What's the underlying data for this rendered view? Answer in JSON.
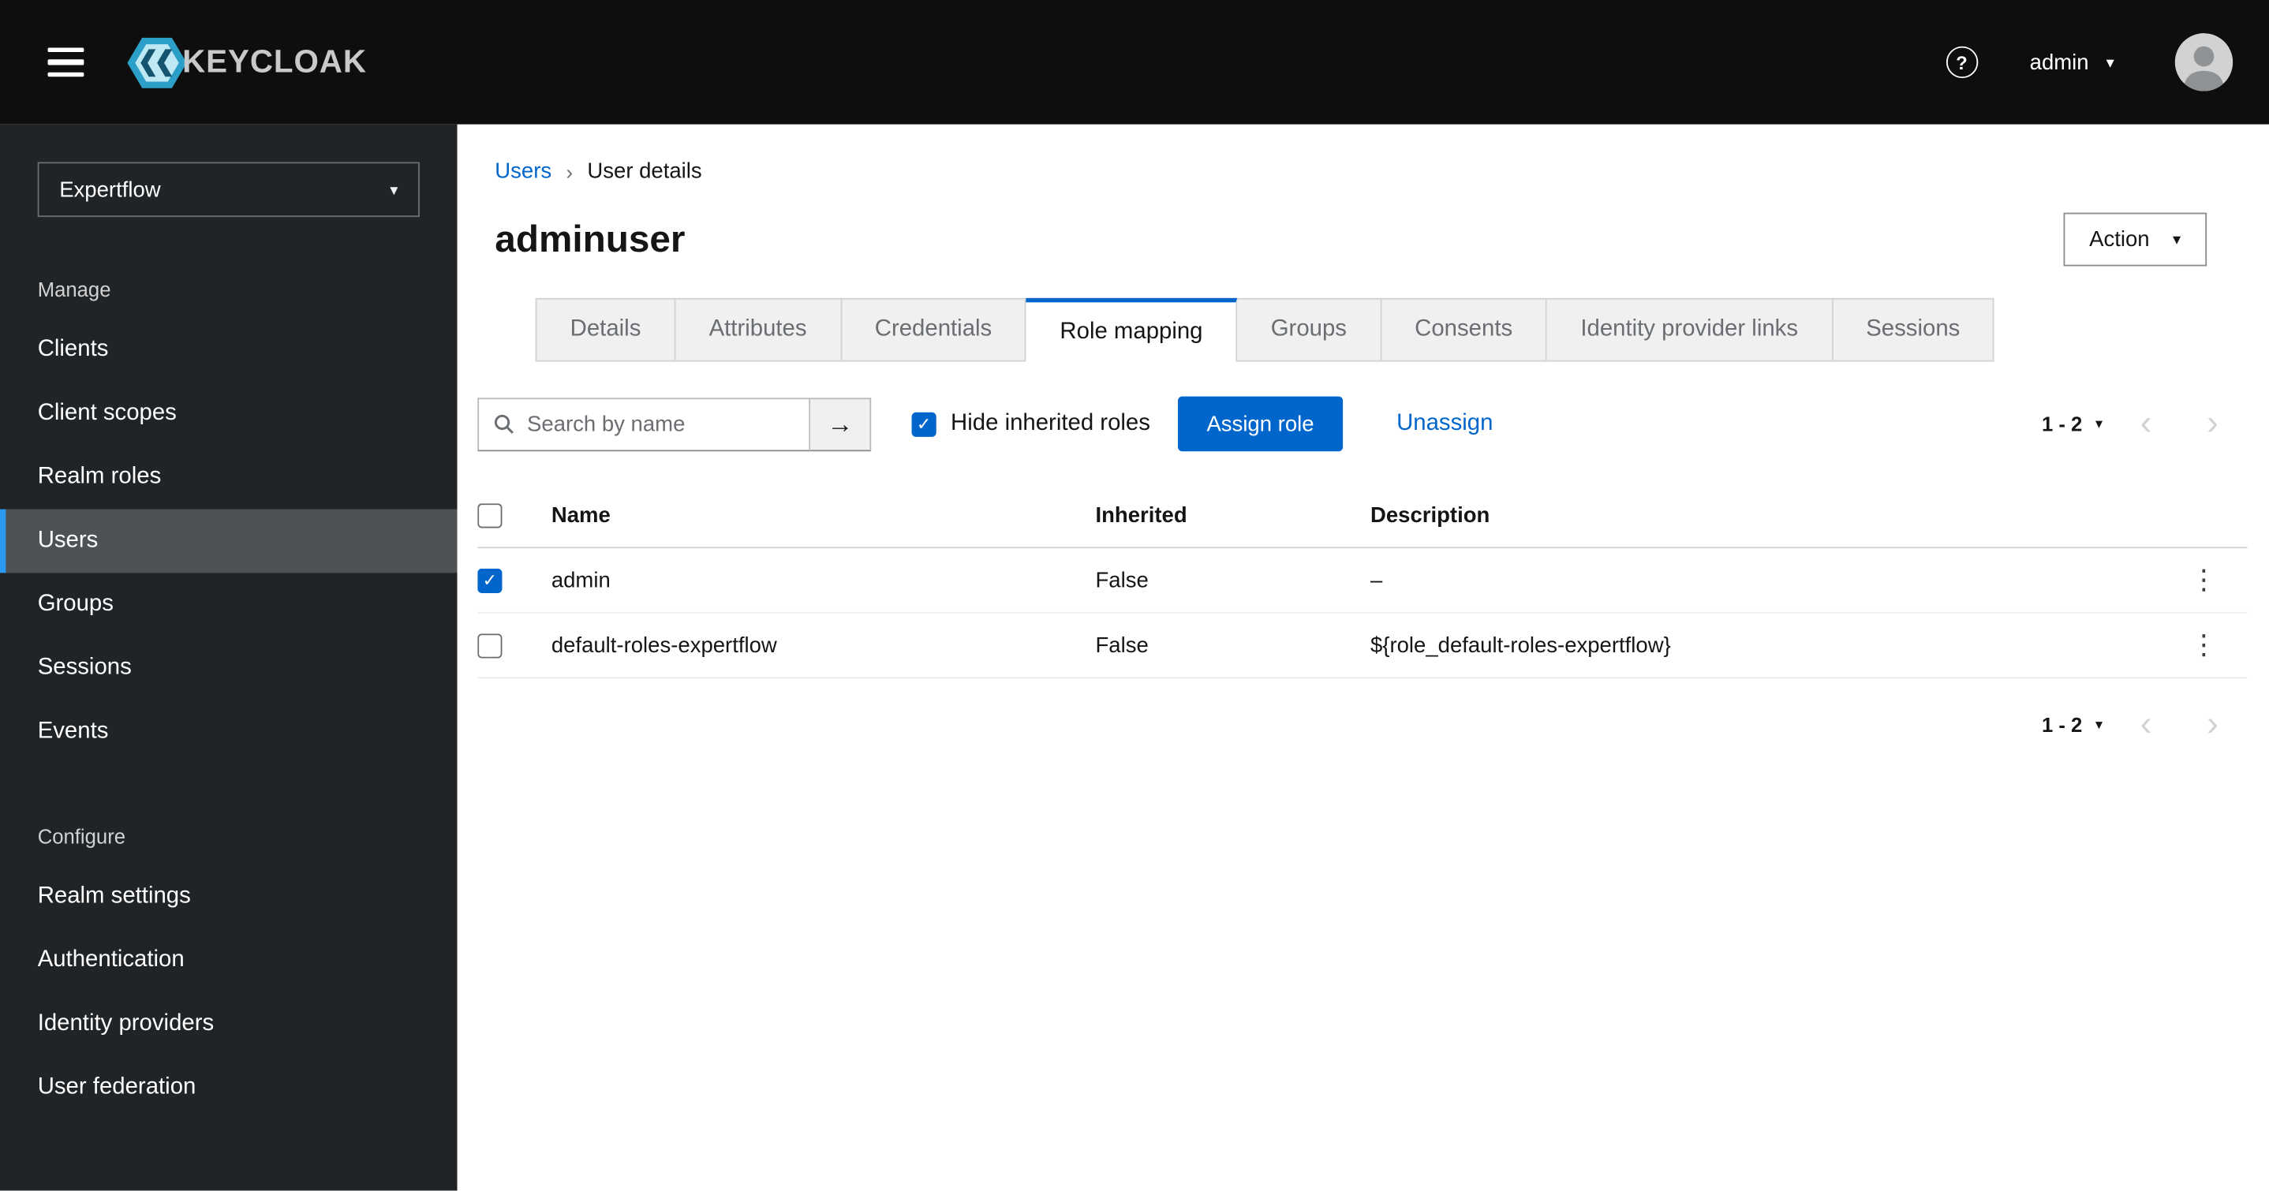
{
  "colors": {
    "masthead_bg": "#0e0e0e",
    "sidebar_bg": "#212427",
    "sidebar_selected_bg": "#4f5255",
    "sidebar_selected_border": "#2b9af3",
    "accent_blue": "#0066cc",
    "link_blue": "#0066cc",
    "tab_inactive_bg": "#f0f0f0",
    "border_gray": "#d2d2d2",
    "text_dark": "#151515",
    "text_gray": "#6a6e73"
  },
  "icons": {
    "caret_down": "▾",
    "chevron_left": "‹",
    "chevron_right": "›",
    "breadcrumb_separator": "›",
    "arrow_right": "→",
    "kebab": "⋮",
    "check": "✓",
    "help": "?"
  },
  "header": {
    "brand": "KEYCLOAK",
    "username": "admin"
  },
  "sidebar": {
    "realm": "Expertflow",
    "selected": "Users",
    "sections": [
      {
        "label": "Manage",
        "items": [
          {
            "label": "Clients"
          },
          {
            "label": "Client scopes"
          },
          {
            "label": "Realm roles"
          },
          {
            "label": "Users"
          },
          {
            "label": "Groups"
          },
          {
            "label": "Sessions"
          },
          {
            "label": "Events"
          }
        ]
      },
      {
        "label": "Configure",
        "items": [
          {
            "label": "Realm settings"
          },
          {
            "label": "Authentication"
          },
          {
            "label": "Identity providers"
          },
          {
            "label": "User federation"
          }
        ]
      }
    ]
  },
  "breadcrumb": {
    "parent": "Users",
    "current": "User details"
  },
  "page": {
    "title": "adminuser",
    "action_button": "Action"
  },
  "tabs": {
    "active": "Role mapping",
    "items": [
      {
        "label": "Details"
      },
      {
        "label": "Attributes"
      },
      {
        "label": "Credentials"
      },
      {
        "label": "Role mapping"
      },
      {
        "label": "Groups"
      },
      {
        "label": "Consents"
      },
      {
        "label": "Identity provider links"
      },
      {
        "label": "Sessions"
      }
    ]
  },
  "toolbar": {
    "search_placeholder": "Search by name",
    "hide_inherited_label": "Hide inherited roles",
    "hide_inherited_checked": true,
    "assign_button": "Assign role",
    "unassign_link": "Unassign",
    "pagination_range": "1 - 2"
  },
  "table": {
    "header_checkbox_checked": false,
    "columns": {
      "name": "Name",
      "inherited": "Inherited",
      "description": "Description"
    },
    "rows": [
      {
        "checked": true,
        "name": "admin",
        "inherited": "False",
        "description": "–"
      },
      {
        "checked": false,
        "name": "default-roles-expertflow",
        "inherited": "False",
        "description": "${role_default-roles-expertflow}"
      }
    ]
  },
  "footer": {
    "pagination_range": "1 - 2"
  }
}
